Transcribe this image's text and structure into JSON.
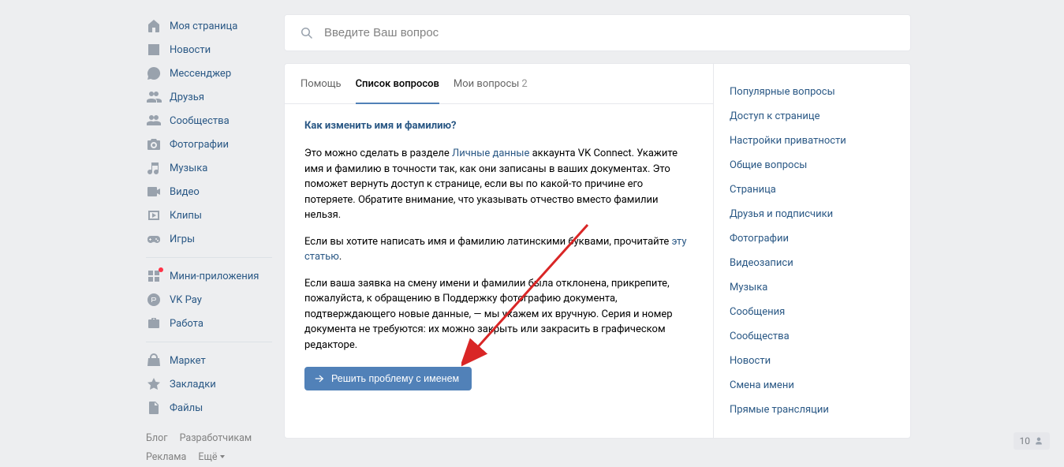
{
  "sidebar": {
    "groups": [
      [
        {
          "icon": "home",
          "label": "Моя страница"
        },
        {
          "icon": "news",
          "label": "Новости"
        },
        {
          "icon": "messenger",
          "label": "Мессенджер"
        },
        {
          "icon": "friends",
          "label": "Друзья"
        },
        {
          "icon": "communities",
          "label": "Сообщества"
        },
        {
          "icon": "photos",
          "label": "Фотографии"
        },
        {
          "icon": "music",
          "label": "Музыка"
        },
        {
          "icon": "video",
          "label": "Видео"
        },
        {
          "icon": "clips",
          "label": "Клипы"
        },
        {
          "icon": "games",
          "label": "Игры"
        }
      ],
      [
        {
          "icon": "miniapps",
          "label": "Мини-приложения",
          "badge": true
        },
        {
          "icon": "vkpay",
          "label": "VK Pay"
        },
        {
          "icon": "work",
          "label": "Работа"
        }
      ],
      [
        {
          "icon": "market",
          "label": "Маркет"
        },
        {
          "icon": "bookmarks",
          "label": "Закладки"
        },
        {
          "icon": "files",
          "label": "Файлы"
        }
      ]
    ],
    "footer": {
      "links": [
        "Блог",
        "Разработчикам",
        "Реклама",
        "Ещё"
      ]
    }
  },
  "search": {
    "placeholder": "Введите Ваш вопрос"
  },
  "tabs": {
    "items": [
      {
        "label": "Помощь",
        "active": false
      },
      {
        "label": "Список вопросов",
        "active": true
      },
      {
        "label": "Мои вопросы",
        "count": "2",
        "active": false
      }
    ]
  },
  "article": {
    "title": "Как изменить имя и фамилию?",
    "p1_a": "Это можно сделать в разделе ",
    "p1_link": "Личные данные",
    "p1_b": " аккаунта VK Connect. Укажите имя и фамилию в точности так, как они записаны в ваших документах. Это поможет вернуть доступ к странице, если вы по какой-то причине его потеряете. Обратите внимание, что указывать отчество вместо фамилии нельзя.",
    "p2_a": "Если вы хотите написать имя и фамилию латинскими буквами, прочитайте ",
    "p2_link": "эту статью",
    "p2_b": ".",
    "p3": "Если ваша заявка на смену имени и фамилии была отклонена, прикрепите, пожалуйста, к обращению в Поддержку фотографию документа, подтверждающего новые данные, — мы укажем их вручную. Серия и номер документа не требуются: их можно закрыть или закрасить в графическом редакторе.",
    "button": "Решить проблему с именем"
  },
  "aside": {
    "items": [
      "Популярные вопросы",
      "Доступ к странице",
      "Настройки приватности",
      "Общие вопросы",
      "Страница",
      "Друзья и подписчики",
      "Фотографии",
      "Видеозаписи",
      "Музыка",
      "Сообщения",
      "Сообщества",
      "Новости",
      "Смена имени",
      "Прямые трансляции"
    ]
  },
  "badge": {
    "count": "10"
  },
  "colors": {
    "accent": "#5181b8",
    "link": "#2a5885",
    "arrow": "#d92626"
  }
}
